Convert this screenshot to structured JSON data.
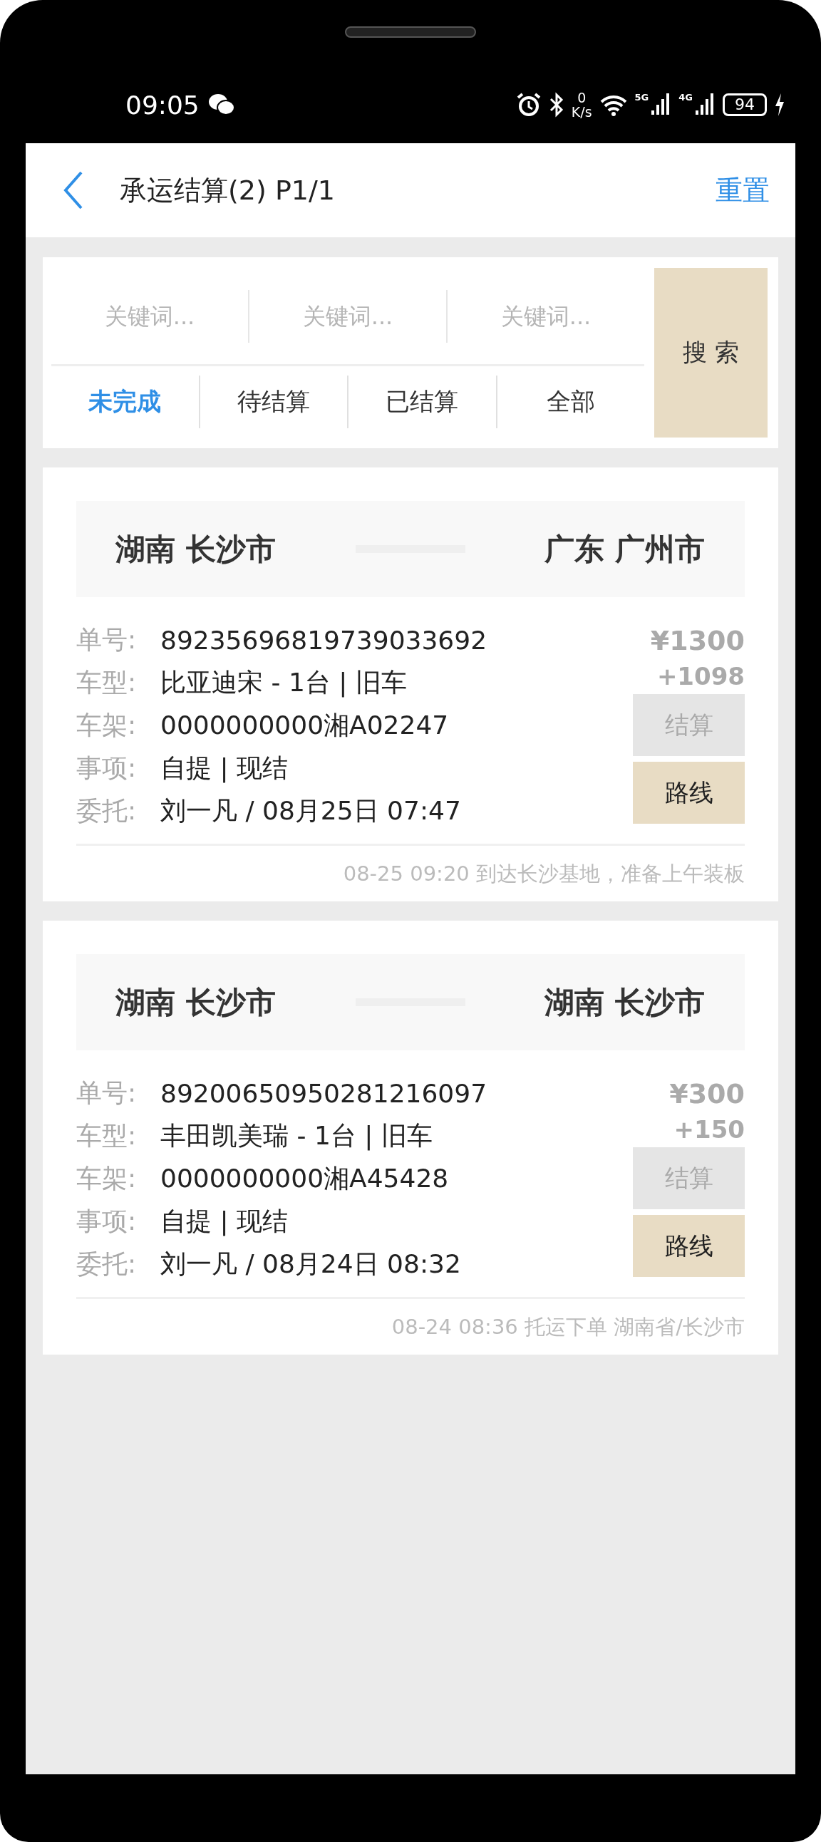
{
  "status_bar": {
    "time": "09:05",
    "net_speed": "0",
    "net_unit": "K/s",
    "signals": [
      "5G",
      "4G"
    ],
    "battery": "94"
  },
  "header": {
    "title": "承运结算(2) P1/1",
    "action": "重置"
  },
  "search": {
    "placeholders": [
      "关键词...",
      "关键词...",
      "关键词..."
    ],
    "button": "搜 索",
    "filters": [
      {
        "label": "未完成",
        "selected": true
      },
      {
        "label": "待结算",
        "selected": false
      },
      {
        "label": "已结算",
        "selected": false
      },
      {
        "label": "全部",
        "selected": false
      }
    ]
  },
  "orders": [
    {
      "from": "湖南 长沙市",
      "to": "广东 广州市",
      "fields": [
        {
          "label": "单号:",
          "value": "89235696819739033692"
        },
        {
          "label": "车型:",
          "value": "比亚迪宋 - 1台 | 旧车"
        },
        {
          "label": "车架:",
          "value": "0000000000湘A02247"
        },
        {
          "label": "事项:",
          "value": "自提 | 现结"
        },
        {
          "label": "委托:",
          "value": "刘一凡 / 08月25日 07:47"
        }
      ],
      "price": "¥1300",
      "extra": "+1098",
      "buttons": [
        {
          "label": "结算",
          "disabled": true
        },
        {
          "label": "路线",
          "disabled": false
        }
      ],
      "status": "08-25 09:20 到达长沙基地，准备上午装板"
    },
    {
      "from": "湖南 长沙市",
      "to": "湖南 长沙市",
      "fields": [
        {
          "label": "单号:",
          "value": "89200650950281216097"
        },
        {
          "label": "车型:",
          "value": "丰田凯美瑞 - 1台 | 旧车"
        },
        {
          "label": "车架:",
          "value": "0000000000湘A45428"
        },
        {
          "label": "事项:",
          "value": "自提 | 现结"
        },
        {
          "label": "委托:",
          "value": "刘一凡 / 08月24日 08:32"
        }
      ],
      "price": "¥300",
      "extra": "+150",
      "buttons": [
        {
          "label": "结算",
          "disabled": true
        },
        {
          "label": "路线",
          "disabled": false
        }
      ],
      "status": "08-24 08:36 托运下单 湖南省/长沙市"
    }
  ]
}
